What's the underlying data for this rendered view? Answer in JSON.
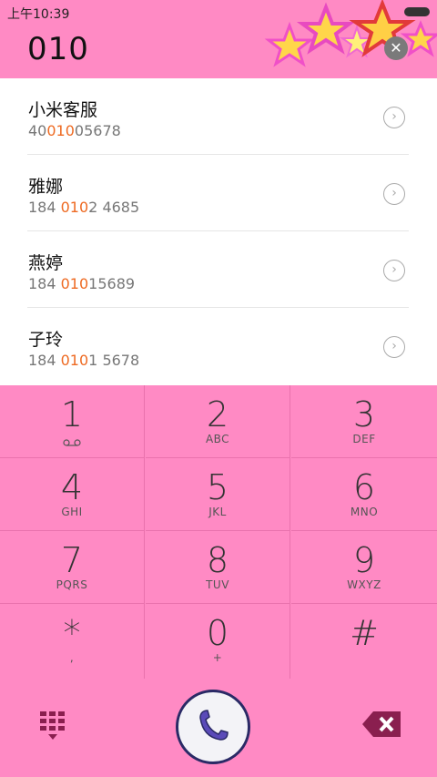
{
  "status": {
    "time": "上午10:39"
  },
  "header": {
    "number": "010"
  },
  "contacts": [
    {
      "name": "小米客服",
      "num_pre": "40",
      "num_hl": "010",
      "num_post": "05678"
    },
    {
      "name": "雅娜",
      "num_pre": "184 ",
      "num_hl": "010",
      "num_post": "2 4685"
    },
    {
      "name": "燕婷",
      "num_pre": "184 ",
      "num_hl": "010",
      "num_post": "15689"
    },
    {
      "name": "子玲",
      "num_pre": "184 ",
      "num_hl": "010",
      "num_post": "1 5678"
    }
  ],
  "keypad": [
    {
      "digit": "1",
      "letters": ""
    },
    {
      "digit": "2",
      "letters": "ABC"
    },
    {
      "digit": "3",
      "letters": "DEF"
    },
    {
      "digit": "4",
      "letters": "GHI"
    },
    {
      "digit": "5",
      "letters": "JKL"
    },
    {
      "digit": "6",
      "letters": "MNO"
    },
    {
      "digit": "7",
      "letters": "PQRS"
    },
    {
      "digit": "8",
      "letters": "TUV"
    },
    {
      "digit": "9",
      "letters": "WXYZ"
    },
    {
      "digit": "*",
      "letters": ","
    },
    {
      "digit": "0",
      "letters": "+"
    },
    {
      "digit": "#",
      "letters": ""
    }
  ],
  "icons": {
    "voicemail": "voicemail-icon",
    "dialpad": "dialpad-icon",
    "call": "phone-icon",
    "backspace": "backspace-icon",
    "clear": "close-icon",
    "chevron": "chevron-right-icon"
  },
  "colors": {
    "pink": "#ff8ac4",
    "highlight": "#ee6a22"
  }
}
